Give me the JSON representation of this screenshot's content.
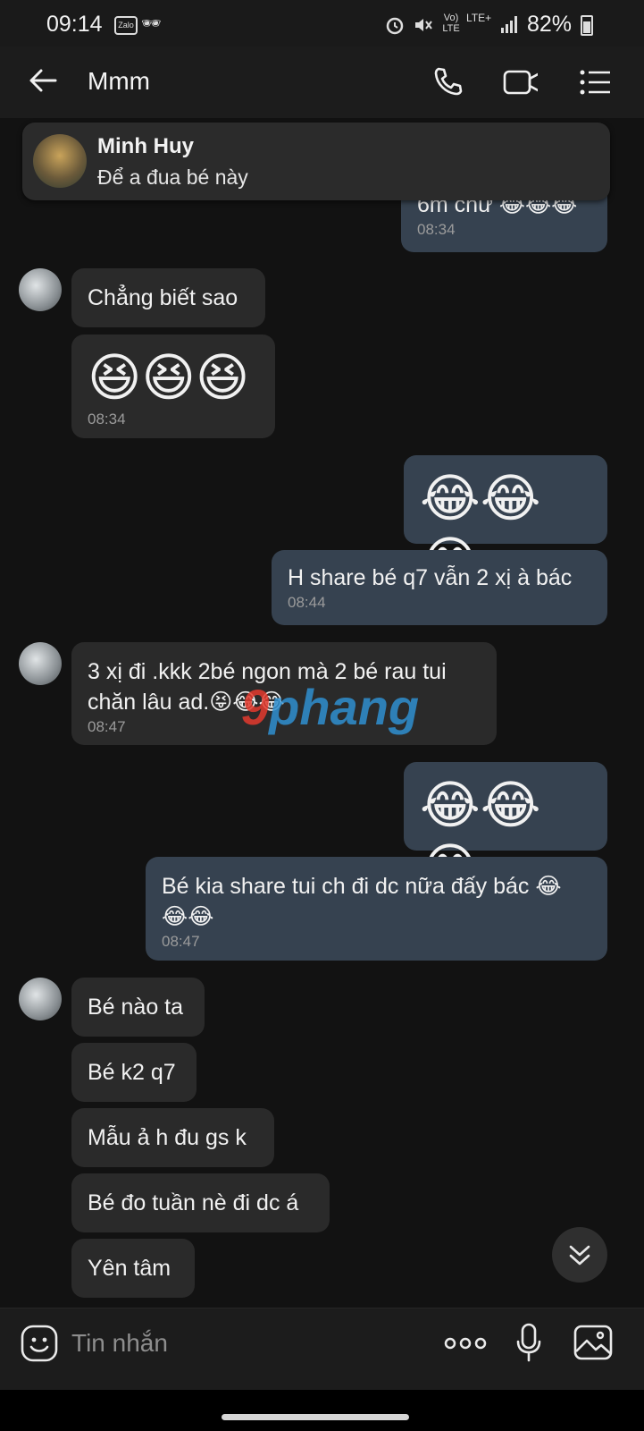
{
  "status_bar": {
    "time": "09:14",
    "zalo_label": "Zalo",
    "network": "Vo) LTE",
    "network_type": "LTE+",
    "battery": "82%",
    "icons": [
      "zalo-icon",
      "incognito-icon",
      "alarm-icon",
      "mute-icon",
      "volte-icon",
      "lte-icon",
      "signal-icon",
      "battery-icon"
    ]
  },
  "header": {
    "back_icon": "back-arrow-icon",
    "title": "Mmm",
    "call_icon": "phone-icon",
    "video_icon": "video-call-icon",
    "menu_icon": "list-menu-icon"
  },
  "notification": {
    "sender": "Minh Huy",
    "message": "Để a đua bé này"
  },
  "messages": [
    {
      "side": "out",
      "text": "6m chư 😂😂😂",
      "time": "08:34"
    },
    {
      "side": "in",
      "text": "Chẳng biết sao",
      "time": ""
    },
    {
      "side": "in",
      "text": "😆😆😆",
      "time": "08:34"
    },
    {
      "side": "out",
      "text": "😂😂😂",
      "time": ""
    },
    {
      "side": "out",
      "text": "H share bé q7 vẫn 2 xị à bác",
      "time": "08:44"
    },
    {
      "side": "in",
      "text_line1": "3 xị đi .kkk 2bé ngon mà 2 bé rau tui",
      "text_line2": "chăn lâu ad.😝😂😂",
      "time": "08:47"
    },
    {
      "side": "out",
      "text": "😂😂😂",
      "time": ""
    },
    {
      "side": "out",
      "text_line1": "Bé kia share tui ch đi dc nữa đấy bác 😂",
      "text_line2": "😂😂",
      "time": "08:47"
    },
    {
      "side": "in",
      "text": "Bé nào ta"
    },
    {
      "side": "in",
      "text": "Bé k2 q7"
    },
    {
      "side": "in",
      "text": "Mẫu ả h đu gs k"
    },
    {
      "side": "in",
      "text": "Bé đo tuần nè đi dc á"
    },
    {
      "side": "in",
      "text": "Yên tâm"
    }
  ],
  "watermark": {
    "part1": "9",
    "part2": "phang"
  },
  "input": {
    "placeholder": "Tin nhắn",
    "emoji_icon": "emoji-icon",
    "more_icon": "more-options-icon",
    "mic_icon": "microphone-icon",
    "image_icon": "image-icon"
  },
  "scroll_down_icon": "chevrons-down-icon"
}
